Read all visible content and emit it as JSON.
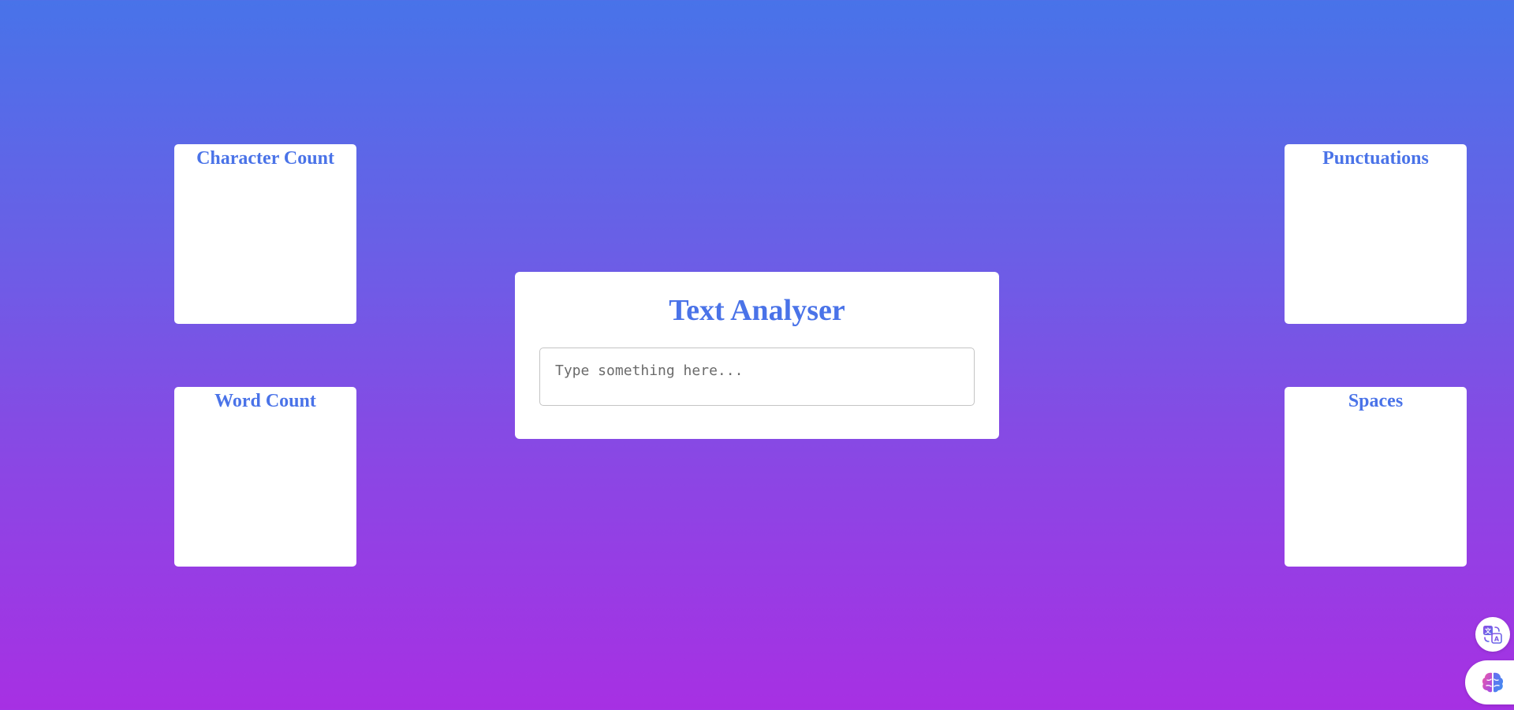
{
  "app": {
    "title": "Text Analyser"
  },
  "input": {
    "placeholder": "Type something here...",
    "value": ""
  },
  "stats": {
    "character_count": {
      "label": "Character Count",
      "value": ""
    },
    "word_count": {
      "label": "Word Count",
      "value": ""
    },
    "punctuations": {
      "label": "Punctuations",
      "value": ""
    },
    "spaces": {
      "label": "Spaces",
      "value": ""
    }
  },
  "floating_buttons": {
    "translate": {
      "icon": "translate-icon"
    },
    "assistant": {
      "icon": "brain-icon"
    }
  },
  "colors": {
    "accent": "#4a73e8",
    "gradient_top": "#4873e9",
    "gradient_bottom": "#a730e3",
    "card_bg": "#ffffff"
  }
}
